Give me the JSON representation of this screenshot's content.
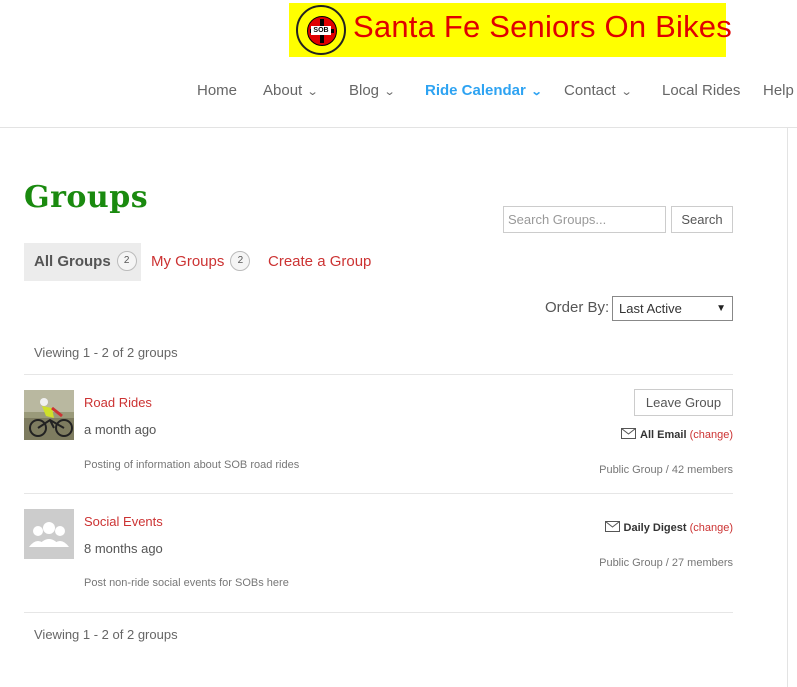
{
  "header": {
    "logo_title": "Santa Fe Seniors On Bikes",
    "logo_badge_top": "Seniors On Bikes",
    "logo_badge_center": "SOB",
    "nav": [
      {
        "label": "Home"
      },
      {
        "label": "About"
      },
      {
        "label": "Blog"
      },
      {
        "label": "Ride Calendar"
      },
      {
        "label": "Contact"
      },
      {
        "label": "Local Rides"
      },
      {
        "label": "Help"
      }
    ]
  },
  "page": {
    "title": "Groups",
    "search": {
      "placeholder": "Search Groups...",
      "button": "Search"
    },
    "tabs": [
      {
        "label": "All Groups",
        "count": "2"
      },
      {
        "label": "My Groups",
        "count": "2"
      },
      {
        "label": "Create a Group"
      }
    ],
    "order": {
      "label": "Order By:",
      "selected": "Last Active"
    },
    "viewing_top": "Viewing 1 - 2 of 2 groups",
    "viewing_bottom": "Viewing 1 - 2 of 2 groups",
    "groups": [
      {
        "name": "Road Rides",
        "active": "a month ago",
        "description": "Posting of information about SOB road rides",
        "action": "Leave Group",
        "email_setting": "All Email",
        "change_label": "(change)",
        "meta": "Public Group / 42 members",
        "avatar_icon": "cyclist-photo"
      },
      {
        "name": "Social Events",
        "active": "8 months ago",
        "description": "Post non-ride social events for SOBs here",
        "email_setting": "Daily Digest",
        "change_label": "(change)",
        "meta": "Public Group / 27 members",
        "avatar_icon": "group-people-icon"
      }
    ]
  },
  "colors": {
    "accent": "#2ea3f2",
    "link": "#cc3333",
    "title_green": "#1a8a0f"
  }
}
